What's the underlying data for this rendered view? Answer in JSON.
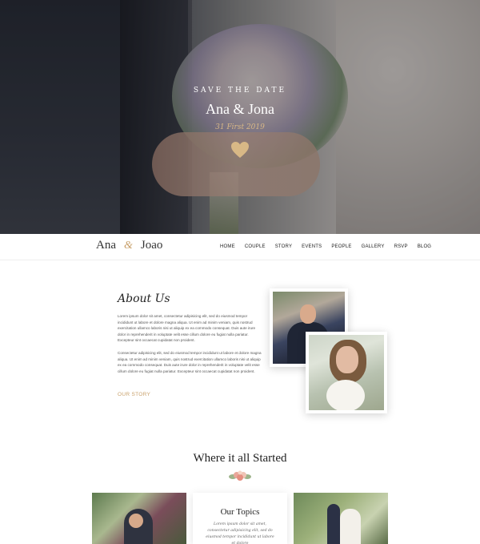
{
  "hero": {
    "tagline": "SAVE THE DATE",
    "names": "Ana & Jona",
    "date": "31 First 2019"
  },
  "nav": {
    "brand_left": "Ana",
    "brand_amp": "&",
    "brand_right": "Joao",
    "items": [
      "HOME",
      "COUPLE",
      "STORY",
      "EVENTS",
      "PEOPLE",
      "GALLERY",
      "RSVP",
      "BLOG"
    ]
  },
  "about": {
    "title": "About Us",
    "paragraph1": "Lorem ipsum dolor sit amet, consectetur adipisicing elit, sed do eiusmod tempor incididunt ut labore et dolore magna aliqua. Ut enim ad minim veniam, quis nostrud exercitation ullamco laboris nisi ut aliquip ex ea commodo consequat. Duis aute irure dolor in reprehenderit in voluptate velit esse cillum dolore eu fugiat nulla pariatur. Excepteur sint occaecat cupidatat non proident.",
    "paragraph2": "Consectetur adipisicing elit, sed do eiusmod tempor incididunt ut labore et dolore magna aliqua. Ut enim ad minim veniam, quis nostrud exercitation ullamco laboris nisi ut aliquip ex ea commodo consequat. Duis aute irure dolor in reprehenderit in voluptate velit esse cillum dolore eu fugiat nulla pariatur. Excepteur sint occaecat cupidatat non proident.",
    "link": "OUR STORY"
  },
  "started": {
    "title": "Where it all Started",
    "topics_title": "Our Topics",
    "topics_text": "Lorem ipsum dolor sit amet, consectetur adipisicing elit, sed do eiusmod tempor incididunt ut labore et dolore"
  },
  "colors": {
    "accent": "#c8a06a",
    "heart": "#d8b886"
  }
}
